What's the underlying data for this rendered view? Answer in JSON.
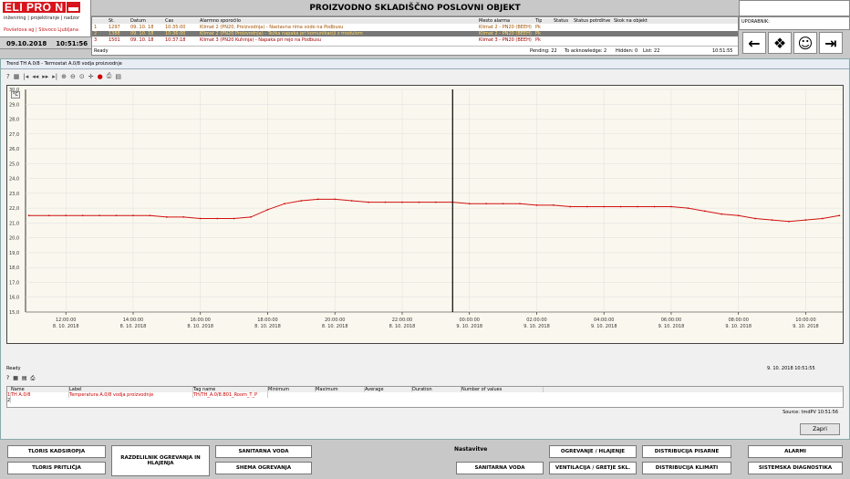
{
  "logo": {
    "text": "ELI PRO N",
    "tagline": "inženiring | projektiranje | nadzor",
    "company": "Povšetova ag | Slovoco Ljubljana"
  },
  "datetime": {
    "date": "09.10.2018",
    "time": "10:51:56"
  },
  "title": "PROIZVODNO SKLADIŠČNO POSLOVNI OBJEKT",
  "alarms": {
    "headers": [
      "Št.",
      "Datum",
      "Čas",
      "Alarmno sporočilo",
      "Mesto alarma",
      "Tip",
      "Status",
      "Status potrditve",
      "Skok na objekt"
    ],
    "rows": [
      [
        "1",
        "1297",
        "09. 10. 18",
        "10:35:00",
        "Klimat 2 (PN20, Proizvodnja) - Nastavna rima vodo na Podbusu",
        "Klimat 2 - PN20 (BEEH)",
        "Pk"
      ],
      [
        "2",
        "1388",
        "09. 10. 18",
        "10:36:00",
        "Klimat 2 (PN20 Proizvodnja) - Težka napaka pri komunikaciji z modulom",
        "Klimat 2 - PN20 (BEEH)",
        "Pk"
      ],
      [
        "3",
        "1501",
        "09. 10. 18",
        "10:37:18",
        "Klimat 3 (PN20 Kuhinja) - Napaka pri rejo na Podbusu",
        "Klimat 3 - PN20 (BEEH)",
        "Pk"
      ]
    ],
    "footer": {
      "ready": "Ready",
      "pending": "Pending: 22",
      "ack": "To acknowledge: 2",
      "hidden": "Hidden: 0",
      "list": "List: 22",
      "time": "10:51:55"
    }
  },
  "user_label": "UPORABNIK:",
  "window_title": "Trend TH A.0/8 - Termostat A.0/8 vodja proizvodnje",
  "plot_unit": "°C",
  "chart_data": {
    "type": "line",
    "yticks": [
      15.0,
      16.0,
      17.0,
      18.0,
      19.0,
      20.0,
      21.0,
      22.0,
      23.0,
      24.0,
      25.0,
      26.0,
      27.0,
      28.0,
      29.0,
      30.0
    ],
    "ylim": [
      15.0,
      30.0
    ],
    "ytick_labels": [
      "15,0",
      "16,0",
      "17,0",
      "18,0",
      "19,0",
      "20,0",
      "21,0",
      "22,0",
      "23,0",
      "24,0",
      "25,0",
      "26,0",
      "27,0",
      "28,0",
      "29,0",
      "30,0"
    ],
    "xticks": [
      {
        "time": "12:00:00",
        "date": "8. 10. 2018"
      },
      {
        "time": "14:00:00",
        "date": "8. 10. 2018"
      },
      {
        "time": "16:00:00",
        "date": "8. 10. 2018"
      },
      {
        "time": "18:00:00",
        "date": "8. 10. 2018"
      },
      {
        "time": "20:00:00",
        "date": "8. 10. 2018"
      },
      {
        "time": "22:00:00",
        "date": "8. 10. 2018"
      },
      {
        "time": "00:00:00",
        "date": "9. 10. 2018"
      },
      {
        "time": "02:00:00",
        "date": "9. 10. 2018"
      },
      {
        "time": "04:00:00",
        "date": "9. 10. 2018"
      },
      {
        "time": "06:00:00",
        "date": "9. 10. 2018"
      },
      {
        "time": "08:00:00",
        "date": "9. 10. 2018"
      },
      {
        "time": "10:00:00",
        "date": "9. 10. 2018"
      }
    ],
    "x_hours": [
      10.9,
      11.5,
      12.0,
      12.5,
      13.0,
      13.5,
      14.0,
      14.5,
      15.0,
      15.5,
      16.0,
      16.5,
      17.0,
      17.5,
      18.0,
      18.5,
      19.0,
      19.5,
      20.0,
      20.5,
      21.0,
      21.5,
      22.0,
      22.5,
      23.0,
      23.5,
      24.0,
      24.5,
      25.0,
      25.5,
      26.0,
      26.5,
      27.0,
      27.5,
      28.0,
      28.5,
      29.0,
      29.5,
      30.0,
      30.5,
      31.0,
      31.5,
      32.0,
      32.5,
      33.0,
      33.5,
      34.0,
      34.5,
      35.0
    ],
    "y_values": [
      21.5,
      21.5,
      21.5,
      21.5,
      21.5,
      21.5,
      21.5,
      21.5,
      21.4,
      21.4,
      21.3,
      21.3,
      21.3,
      21.4,
      21.9,
      22.3,
      22.5,
      22.6,
      22.6,
      22.5,
      22.4,
      22.4,
      22.4,
      22.4,
      22.4,
      22.4,
      22.3,
      22.3,
      22.3,
      22.3,
      22.2,
      22.2,
      22.1,
      22.1,
      22.1,
      22.1,
      22.1,
      22.1,
      22.1,
      22.0,
      21.8,
      21.6,
      21.5,
      21.3,
      21.2,
      21.1,
      21.2,
      21.3,
      21.5
    ],
    "cursor_hour": 23.5,
    "color": "#d01010"
  },
  "ready": "Ready",
  "status_datetime": "9. 10. 2018  10:51:55",
  "trend_table": {
    "headers": [
      "Name",
      "Label",
      "Tag name",
      "Minimum",
      "Maximum",
      "Average",
      "Duration",
      "Number of values"
    ],
    "rows": [
      [
        "1",
        "TH A.0/8",
        "Temperatura A.0/8 vodja proizvodnje",
        "TH/TH_A.0/8.B01_Room_T_P",
        "",
        "",
        "",
        "",
        ""
      ],
      [
        "2",
        "",
        "",
        "",
        "",
        "",
        "",
        "",
        ""
      ]
    ]
  },
  "source": "Source: tmdPV   10:51:56",
  "close_label": "Zapri",
  "bottom": {
    "tloris_kadsiropja": "TLORIS KADSIROPJA",
    "tloris_pritlicja": "TLORIS PRITLIČJA",
    "razdelilnik": "RAZDELILNIK OGREVANJA IN HLAJENJA",
    "sanitarna_voda": "SANITARNA VODA",
    "shema_ogrevanja": "SHEMA OGREVANJA",
    "nastavitve": "Nastavitve",
    "sanitarna_voda2": "SANITARNA VODA",
    "ogrevanje_hlajenje": "OGREVANJE / HLAJENJE",
    "ventilacija": "VENTILACIJA / GRETJE SKL.",
    "distribucija_pisarne": "DISTRIBUCIJA PISARNE",
    "distribucija_klimati": "DISTRIBUCIJA KLIMATI",
    "alarmi": "ALARMI",
    "sistemska": "SISTEMSKA DIAGNOSTIKA"
  }
}
